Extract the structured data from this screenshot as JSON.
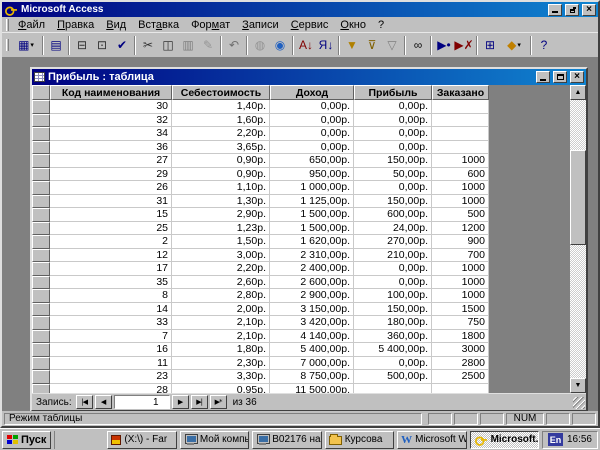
{
  "window": {
    "title": "Microsoft Access",
    "controls_close": "×"
  },
  "menu": {
    "items": [
      {
        "name": "file",
        "pre": "",
        "accel": "Ф",
        "post": "айл"
      },
      {
        "name": "edit",
        "pre": "",
        "accel": "П",
        "post": "равка"
      },
      {
        "name": "view",
        "pre": "",
        "accel": "В",
        "post": "ид"
      },
      {
        "name": "insert",
        "pre": "Вст",
        "accel": "а",
        "post": "вка"
      },
      {
        "name": "format",
        "pre": "Фор",
        "accel": "м",
        "post": "ат"
      },
      {
        "name": "records",
        "pre": "",
        "accel": "З",
        "post": "аписи"
      },
      {
        "name": "tools",
        "pre": "",
        "accel": "С",
        "post": "ервис"
      },
      {
        "name": "window",
        "pre": "",
        "accel": "О",
        "post": "кно"
      },
      {
        "name": "help",
        "pre": "?",
        "accel": "",
        "post": ""
      }
    ]
  },
  "toolbar": {
    "buttons": [
      {
        "name": "view-table",
        "glyph": "▦",
        "color": "#000080",
        "dropdown": true
      },
      {
        "separator": true
      },
      {
        "name": "save",
        "glyph": "▤",
        "color": "#000080"
      },
      {
        "separator": true
      },
      {
        "name": "print",
        "glyph": "⊟",
        "color": "#303030"
      },
      {
        "name": "print-preview",
        "glyph": "⊡",
        "color": "#303030"
      },
      {
        "name": "spelling",
        "glyph": "✔",
        "color": "#000080"
      },
      {
        "separator": true
      },
      {
        "name": "cut",
        "glyph": "✂",
        "color": "#303030"
      },
      {
        "name": "copy",
        "glyph": "◫",
        "color": "#303030"
      },
      {
        "name": "paste",
        "glyph": "▥",
        "color": "#303030",
        "disabled": true
      },
      {
        "name": "format-painter",
        "glyph": "✎",
        "color": "#806000",
        "disabled": true
      },
      {
        "separator": true
      },
      {
        "name": "undo",
        "glyph": "↶",
        "color": "#000080",
        "disabled": true
      },
      {
        "separator": true
      },
      {
        "name": "insert-hyperlink",
        "glyph": "◍",
        "color": "#4060a0",
        "disabled": true
      },
      {
        "name": "web-toolbar",
        "glyph": "◉",
        "color": "#2060c0"
      },
      {
        "separator": true
      },
      {
        "name": "sort-ascending",
        "glyph": "А↓",
        "color": "#800000"
      },
      {
        "name": "sort-descending",
        "glyph": "Я↓",
        "color": "#000080"
      },
      {
        "separator": true
      },
      {
        "name": "filter-by-selection",
        "glyph": "▼",
        "color": "#b08000"
      },
      {
        "name": "filter-by-form",
        "glyph": "⊽",
        "color": "#806000"
      },
      {
        "name": "apply-filter",
        "glyph": "▽",
        "color": "#303030",
        "disabled": true
      },
      {
        "separator": true
      },
      {
        "name": "find",
        "glyph": "∞",
        "color": "#101010"
      },
      {
        "separator": true
      },
      {
        "name": "new-record",
        "glyph": "▶•",
        "color": "#000080"
      },
      {
        "name": "delete-record",
        "glyph": "▶✗",
        "color": "#800000"
      },
      {
        "separator": true
      },
      {
        "name": "database-window",
        "glyph": "⊞",
        "color": "#000080"
      },
      {
        "name": "new-object",
        "glyph": "◆",
        "color": "#c08000",
        "dropdown": true
      },
      {
        "separator": true
      },
      {
        "name": "help",
        "glyph": "?",
        "color": "#000080"
      }
    ]
  },
  "table_window": {
    "title": "Прибыль : таблица",
    "columns": [
      "Код наименования",
      "Себестоимость",
      "Доход",
      "Прибыль",
      "Заказано"
    ],
    "rows": [
      [
        "30",
        "1,40р.",
        "0,00р.",
        "0,00р.",
        ""
      ],
      [
        "32",
        "1,60р.",
        "0,00р.",
        "0,00р.",
        ""
      ],
      [
        "34",
        "2,20р.",
        "0,00р.",
        "0,00р.",
        ""
      ],
      [
        "36",
        "3,65р.",
        "0,00р.",
        "0,00р.",
        ""
      ],
      [
        "27",
        "0,90р.",
        "650,00р.",
        "150,00р.",
        "1000"
      ],
      [
        "29",
        "0,90р.",
        "950,00р.",
        "50,00р.",
        "600"
      ],
      [
        "26",
        "1,10р.",
        "1 000,00р.",
        "0,00р.",
        "1000"
      ],
      [
        "31",
        "1,30р.",
        "1 125,00р.",
        "150,00р.",
        "1000"
      ],
      [
        "15",
        "2,90р.",
        "1 500,00р.",
        "600,00р.",
        "500"
      ],
      [
        "25",
        "1,23р.",
        "1 500,00р.",
        "24,00р.",
        "1200"
      ],
      [
        "2",
        "1,50р.",
        "1 620,00р.",
        "270,00р.",
        "900"
      ],
      [
        "12",
        "3,00р.",
        "2 310,00р.",
        "210,00р.",
        "700"
      ],
      [
        "17",
        "2,20р.",
        "2 400,00р.",
        "0,00р.",
        "1000"
      ],
      [
        "35",
        "2,60р.",
        "2 600,00р.",
        "0,00р.",
        "1000"
      ],
      [
        "8",
        "2,80р.",
        "2 900,00р.",
        "100,00р.",
        "1000"
      ],
      [
        "14",
        "2,00р.",
        "3 150,00р.",
        "150,00р.",
        "1500"
      ],
      [
        "33",
        "2,10р.",
        "3 420,00р.",
        "180,00р.",
        "750"
      ],
      [
        "7",
        "2,10р.",
        "4 140,00р.",
        "360,00р.",
        "1800"
      ],
      [
        "16",
        "1,80р.",
        "5 400,00р.",
        "5 400,00р.",
        "3000"
      ],
      [
        "11",
        "2,30р.",
        "7 000,00р.",
        "0,00р.",
        "2800"
      ],
      [
        "23",
        "3,30р.",
        "8 750,00р.",
        "500,00р.",
        "2500"
      ]
    ],
    "partial_row": [
      "28",
      "0,95р.",
      "11 500,00р.",
      "",
      ""
    ],
    "nav": {
      "label": "Запись:",
      "current": "1",
      "of": "из 36",
      "buttons_left": [
        {
          "name": "first-record",
          "glyph": "|◀"
        },
        {
          "name": "previous-record",
          "glyph": "◀"
        }
      ],
      "buttons_right": [
        {
          "name": "next-record",
          "glyph": "▶"
        },
        {
          "name": "last-record",
          "glyph": "▶|"
        },
        {
          "name": "new-record",
          "glyph": "▶*"
        }
      ]
    },
    "scrollbar": {
      "up": "▲",
      "down": "▼"
    }
  },
  "status_bar": {
    "mode": "Режим таблицы",
    "panels": [
      "",
      "",
      "",
      "NUM",
      "",
      ""
    ]
  },
  "taskbar": {
    "start_label": "Пуск",
    "tasks": [
      {
        "name": "far",
        "label": "(X:\\) - Far",
        "icon": "far"
      },
      {
        "name": "my-computer",
        "label": "Мой компь...",
        "icon": "computer"
      },
      {
        "name": "network-drive",
        "label": "В02176 на '...",
        "icon": "computer"
      },
      {
        "name": "folder-kursova",
        "label": "Курсова",
        "icon": "folder"
      },
      {
        "name": "word",
        "label": "Microsoft W...",
        "icon": "word"
      },
      {
        "name": "access",
        "label": "Microsoft...",
        "icon": "key",
        "active": true
      }
    ],
    "icon_glyphs": {
      "word": "W"
    },
    "tray": {
      "lang": "En",
      "time": "16:56"
    }
  },
  "colors": {
    "titlebar_start": "#000080",
    "titlebar_end": "#1084d0",
    "chrome": "#c0c0c0",
    "mdi_background": "#808080",
    "key_gold": "#e8b800"
  }
}
